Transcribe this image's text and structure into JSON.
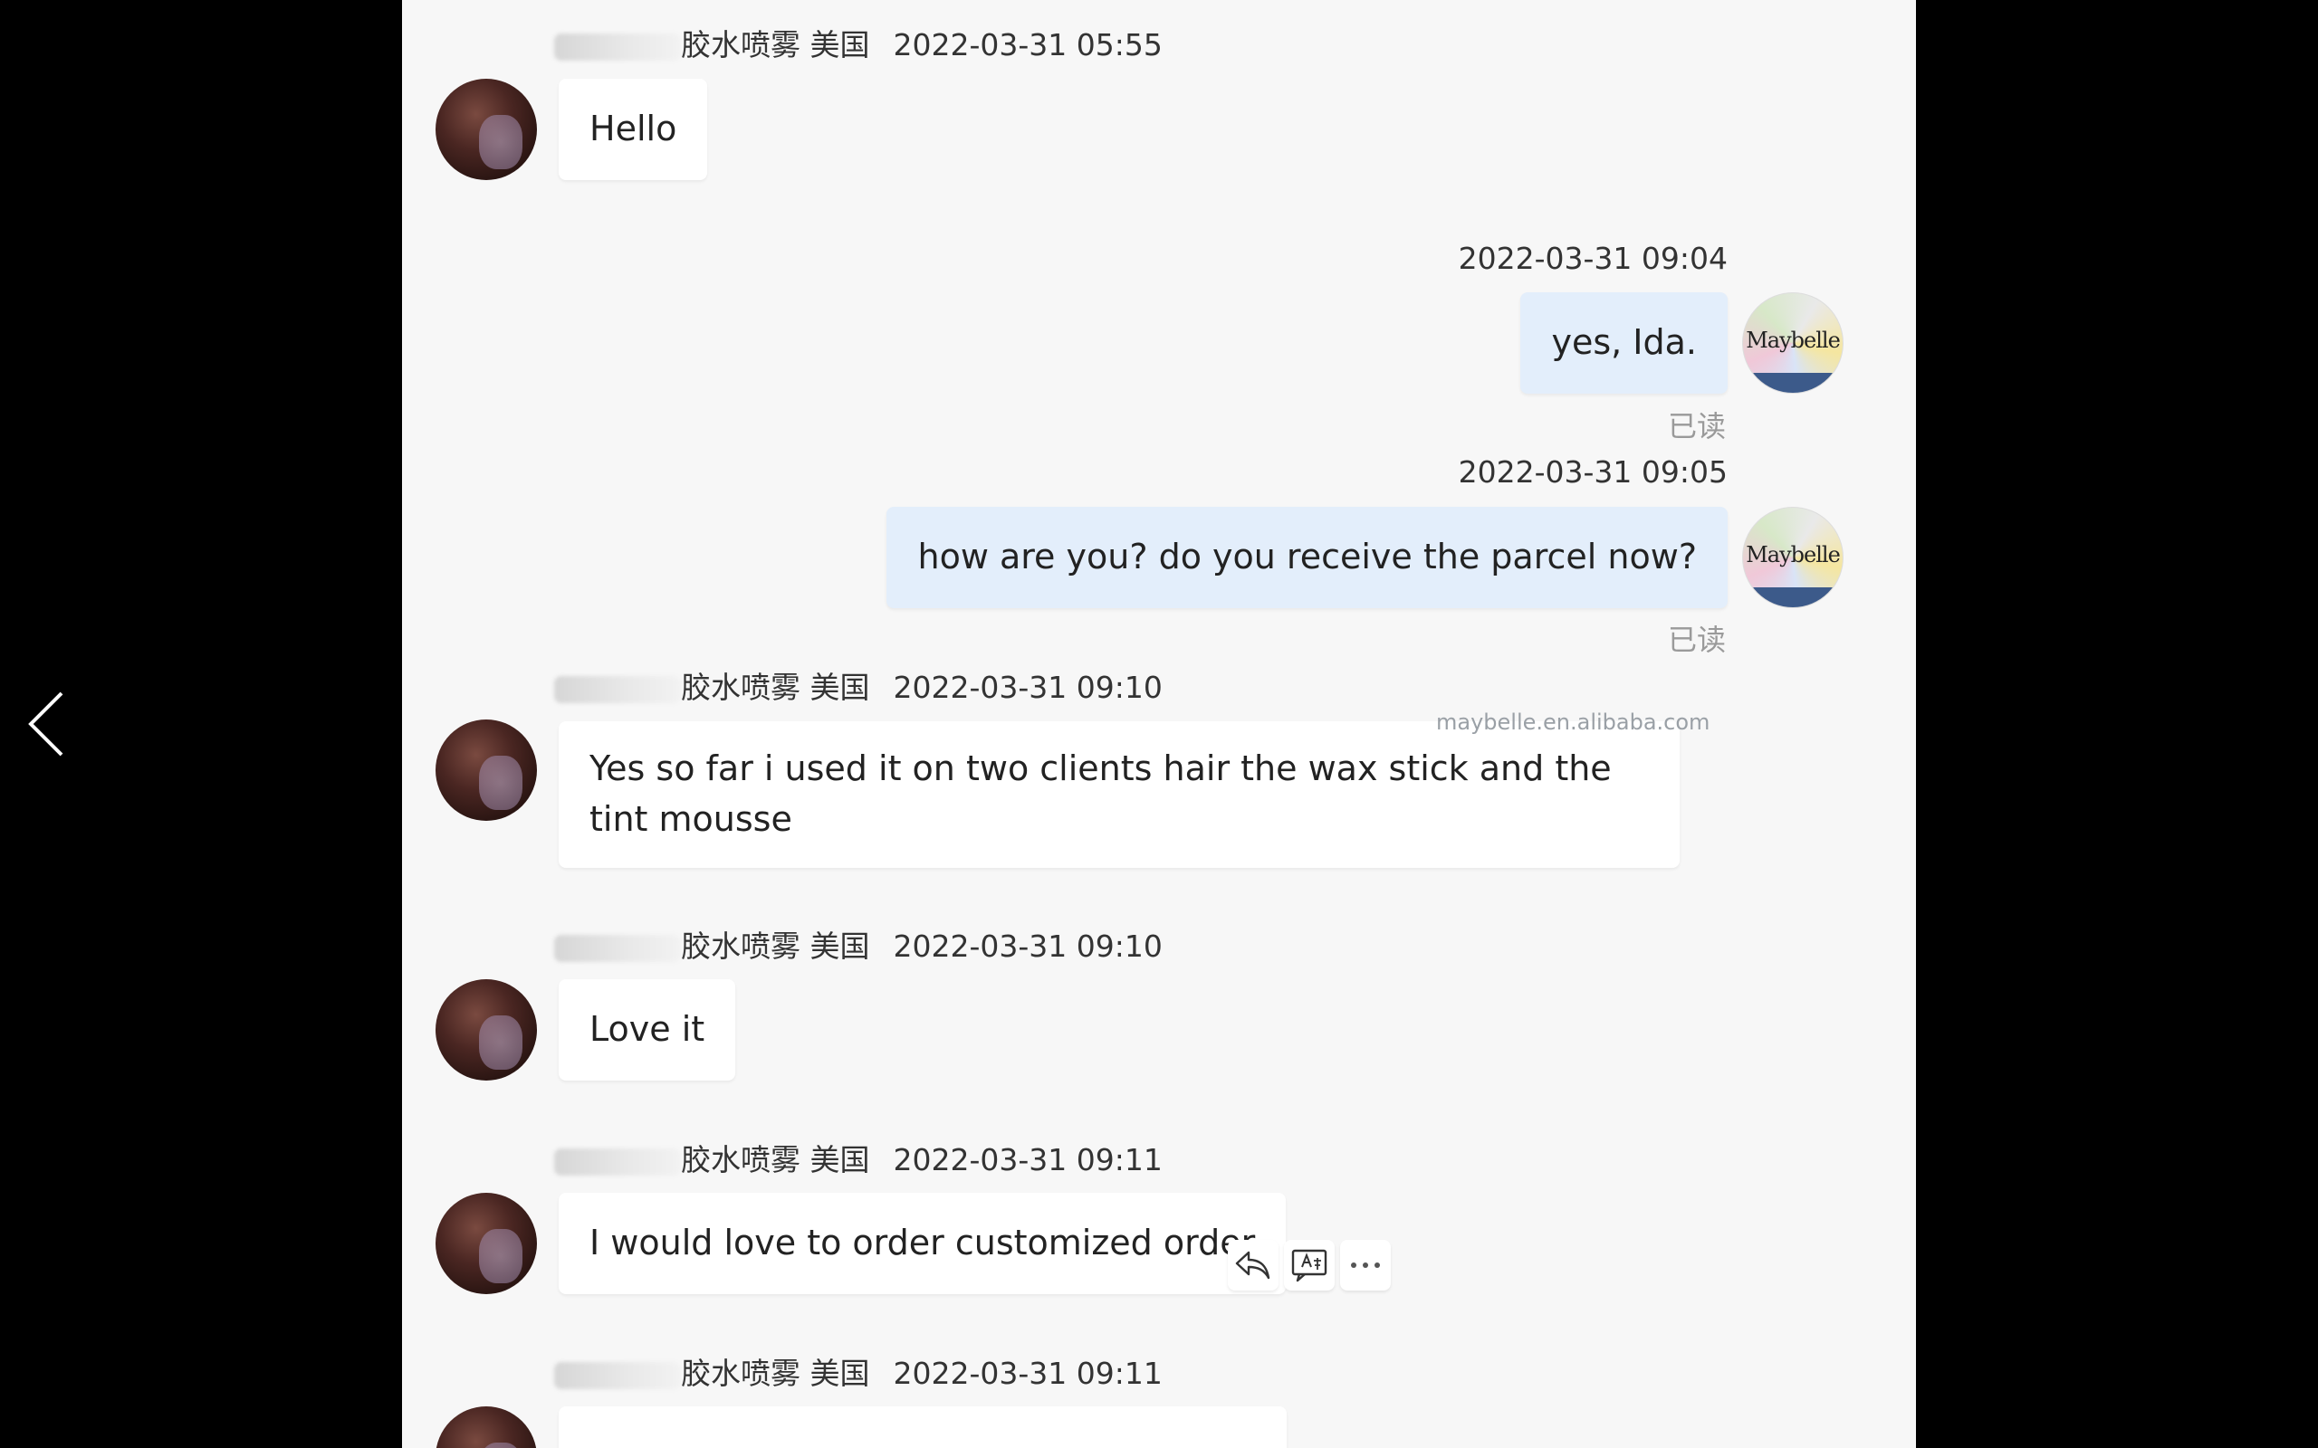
{
  "messages": [
    {
      "sender_suffix": "胶水喷雾 美国",
      "time": "2022-03-31 05:55",
      "text": "Hello"
    },
    {
      "time": "2022-03-31 09:04",
      "text": "yes, Ida.",
      "read": "已读"
    },
    {
      "time": "2022-03-31 09:05",
      "text": "how are you? do you receive the parcel now?",
      "read": "已读"
    },
    {
      "sender_suffix": "胶水喷雾 美国",
      "time": "2022-03-31 09:10",
      "text": "Yes so far i used it on two clients hair the wax stick and the tint mousse"
    },
    {
      "sender_suffix": "胶水喷雾 美国",
      "time": "2022-03-31 09:10",
      "text": "Love it"
    },
    {
      "sender_suffix": "胶水喷雾 美国",
      "time": "2022-03-31 09:11",
      "text": "I would love to order customized order"
    },
    {
      "sender_suffix": "胶水喷雾 美国",
      "time": "2022-03-31 09:11",
      "text": ""
    }
  ],
  "own_avatar_label": "Maybelle",
  "watermark": "maybelle.en.alibaba.com",
  "icons": {
    "back": "chevron-left-icon",
    "reply": "reply-icon",
    "translate": "translate-icon",
    "more": "more-icon"
  }
}
